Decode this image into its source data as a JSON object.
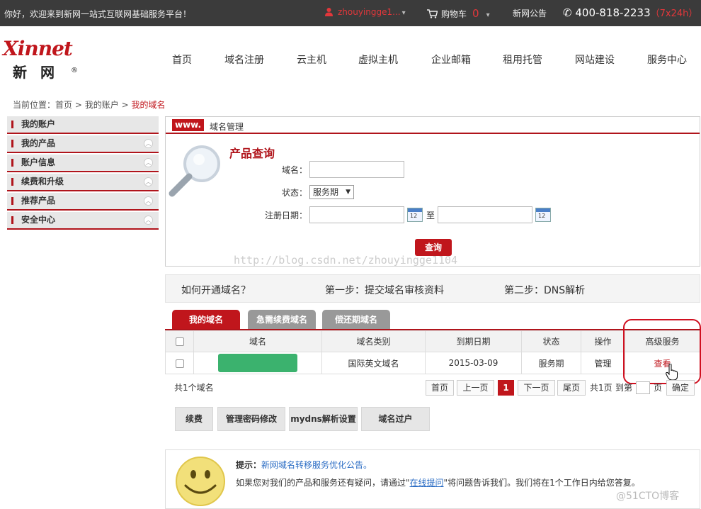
{
  "topbar": {
    "welcome": "你好，欢迎来到新网一站式互联网基础服务平台！",
    "username": "zhouyingge1...",
    "cart_label": "购物车",
    "cart_count": "0",
    "news": "新网公告",
    "phone": "400-818-2233",
    "phone_hours": "（7x24h）"
  },
  "logo": {
    "en": "Xinnet",
    "cn": "新 网"
  },
  "nav": [
    "首页",
    "域名注册",
    "云主机",
    "虚拟主机",
    "企业邮箱",
    "租用托管",
    "网站建设",
    "服务中心"
  ],
  "breadcrumb": {
    "prefix": "当前位置：",
    "items": [
      "首页",
      "我的账户"
    ],
    "current": "我的域名",
    "sep": ">"
  },
  "sidebar": [
    "我的账户",
    "我的产品",
    "账户信息",
    "续费和升级",
    "推荐产品",
    "安全中心"
  ],
  "panel": {
    "badge": "www.",
    "title": "域名管理",
    "query_title": "产品查询",
    "domain_label": "域名：",
    "status_label": "状态：",
    "status_value": "服务期",
    "regdate_label": "注册日期：",
    "date_sep": "至",
    "cal_day": "12",
    "search_button": "查询"
  },
  "watermark": "http://blog.csdn.net/zhouyingge1104",
  "steps": {
    "how": "如何开通域名？",
    "step1": "第一步：提交域名审核资料",
    "step2": "第二步：DNS解析"
  },
  "tabs": [
    "我的域名",
    "急需续费域名",
    "偿还期域名"
  ],
  "table": {
    "headers": [
      "域名",
      "域名类别",
      "到期日期",
      "状态",
      "操作",
      "高级服务"
    ],
    "rows": [
      {
        "type": "国际英文域名",
        "expiry": "2015-03-09",
        "status": "服务期",
        "op": "管理",
        "adv": "查看"
      }
    ]
  },
  "pager": {
    "total": "共1个域名",
    "first": "首页",
    "prev": "上一页",
    "current": "1",
    "next": "下一页",
    "last": "尾页",
    "pages": "共1页",
    "goto": "到第",
    "page_unit": "页",
    "confirm": "确定"
  },
  "actions": [
    "续费",
    "管理密码修改",
    "mydns解析设置",
    "域名过户"
  ],
  "tip": {
    "label": "提示：",
    "notice": "新网域名转移服务优化公告。",
    "before": "如果您对我们的产品和服务还有疑问，请通过\"",
    "link": "在线提问",
    "after": "\"将问题告诉我们。我们将在1个工作日内给您答复。"
  },
  "watermark2": "@51CTO博客",
  "colors": {
    "brand_red": "#c0161c",
    "dark_bar": "#3b3b3b",
    "green": "#3bb26e"
  }
}
